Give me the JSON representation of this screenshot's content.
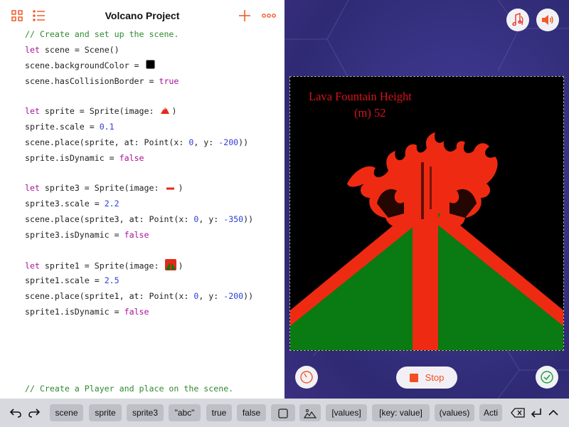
{
  "app": {
    "title": "Volcano Project"
  },
  "toolbar": {
    "grid_icon": "grid-icon",
    "list_icon": "list-icon",
    "add_icon": "plus-icon",
    "more_icon": "more-icon"
  },
  "code": {
    "l1": "// Create and set up the scene.",
    "l2a": "let",
    "l2b": " scene = Scene()",
    "l3a": "scene.backgroundColor = ",
    "l4a": "scene.hasCollisionBorder = ",
    "l4b": "true",
    "l6a": "let",
    "l6b": " sprite = Sprite(image: ",
    "l6c": ")",
    "l7a": "sprite.scale = ",
    "l7b": "0.1",
    "l8a": "scene.place(sprite, at: Point(x: ",
    "l8b": "0",
    "l8c": ", y: ",
    "l8d": "-200",
    "l8e": "))",
    "l9a": "sprite.isDynamic = ",
    "l9b": "false",
    "l11a": "let",
    "l11b": " sprite3 = Sprite(image: ",
    "l11c": ")",
    "l12a": "sprite3.scale = ",
    "l12b": "2.2",
    "l13a": "scene.place(sprite3, at: Point(x: ",
    "l13b": "0",
    "l13c": ", y: ",
    "l13d": "-350",
    "l13e": "))",
    "l14a": "sprite3.isDynamic = ",
    "l14b": "false",
    "l16a": "let",
    "l16b": " sprite1 = Sprite(image: ",
    "l16c": ")",
    "l17a": "sprite1.scale = ",
    "l17b": "2.5",
    "l18a": "scene.place(sprite1, at: Point(x: ",
    "l18b": "0",
    "l18c": ", y: ",
    "l18d": "-200",
    "l18e": "))",
    "l19a": "sprite1.isDynamic = ",
    "l19b": "false",
    "l24": "// Create a Player and place on the scene."
  },
  "live_view": {
    "scene_text_line1": "Lava Fountain Height",
    "scene_text_line2": "(m) 52",
    "stop_label": "Stop",
    "colors": {
      "lava": "#ef2a12",
      "ground": "#0a7a12",
      "sky": "#000000",
      "text": "#d8121a"
    }
  },
  "shortcut_bar": {
    "undo_icon": "undo-icon",
    "redo_icon": "redo-icon",
    "tokens": [
      "scene",
      "sprite",
      "sprite3",
      "\"abc\"",
      "true",
      "false",
      "",
      "",
      "[values]",
      "[key: value]",
      "(values)",
      "Acti"
    ],
    "delete_icon": "delete-icon",
    "return_icon": "return-icon",
    "collapse_icon": "chevron-up-icon"
  },
  "accent_color": "#f05a28"
}
